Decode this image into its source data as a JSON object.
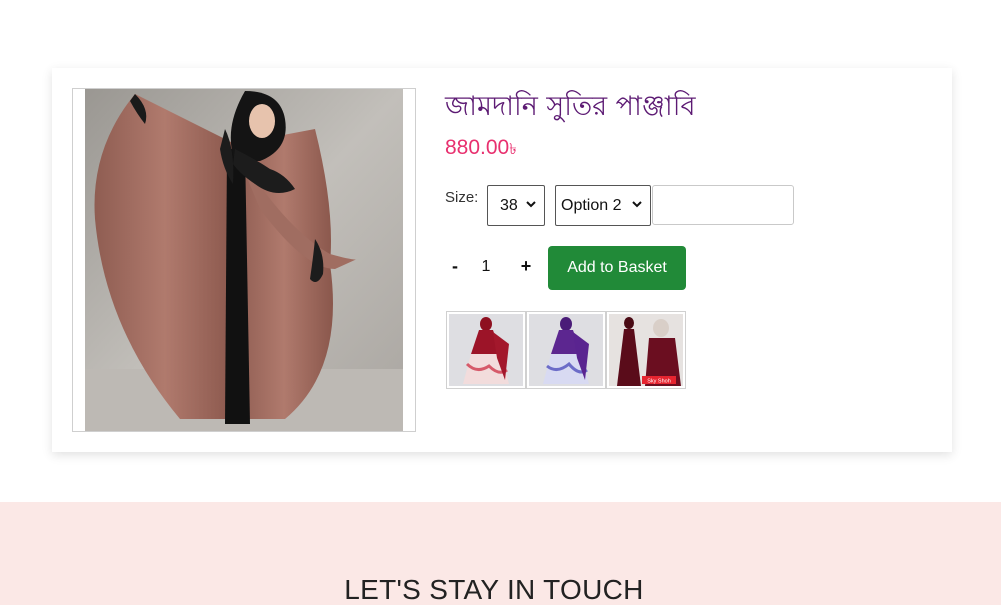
{
  "product": {
    "title": "জামদানি সুতির পাঞ্জাবি",
    "price": "880.00",
    "currency_symbol": "৳",
    "size_label": "Size:",
    "size_selected": "38",
    "option_selected": "Option 2",
    "quantity": "1",
    "minus_label": "-",
    "plus_label": "+",
    "add_button_label": "Add to Basket",
    "thumb_badge": "Sky Shoh"
  },
  "footer": {
    "title": "LET'S STAY IN TOUCH"
  },
  "colors": {
    "title": "#5c1a73",
    "price": "#e8306f",
    "button": "#218a38",
    "footer_bg": "#fbe8e6"
  }
}
